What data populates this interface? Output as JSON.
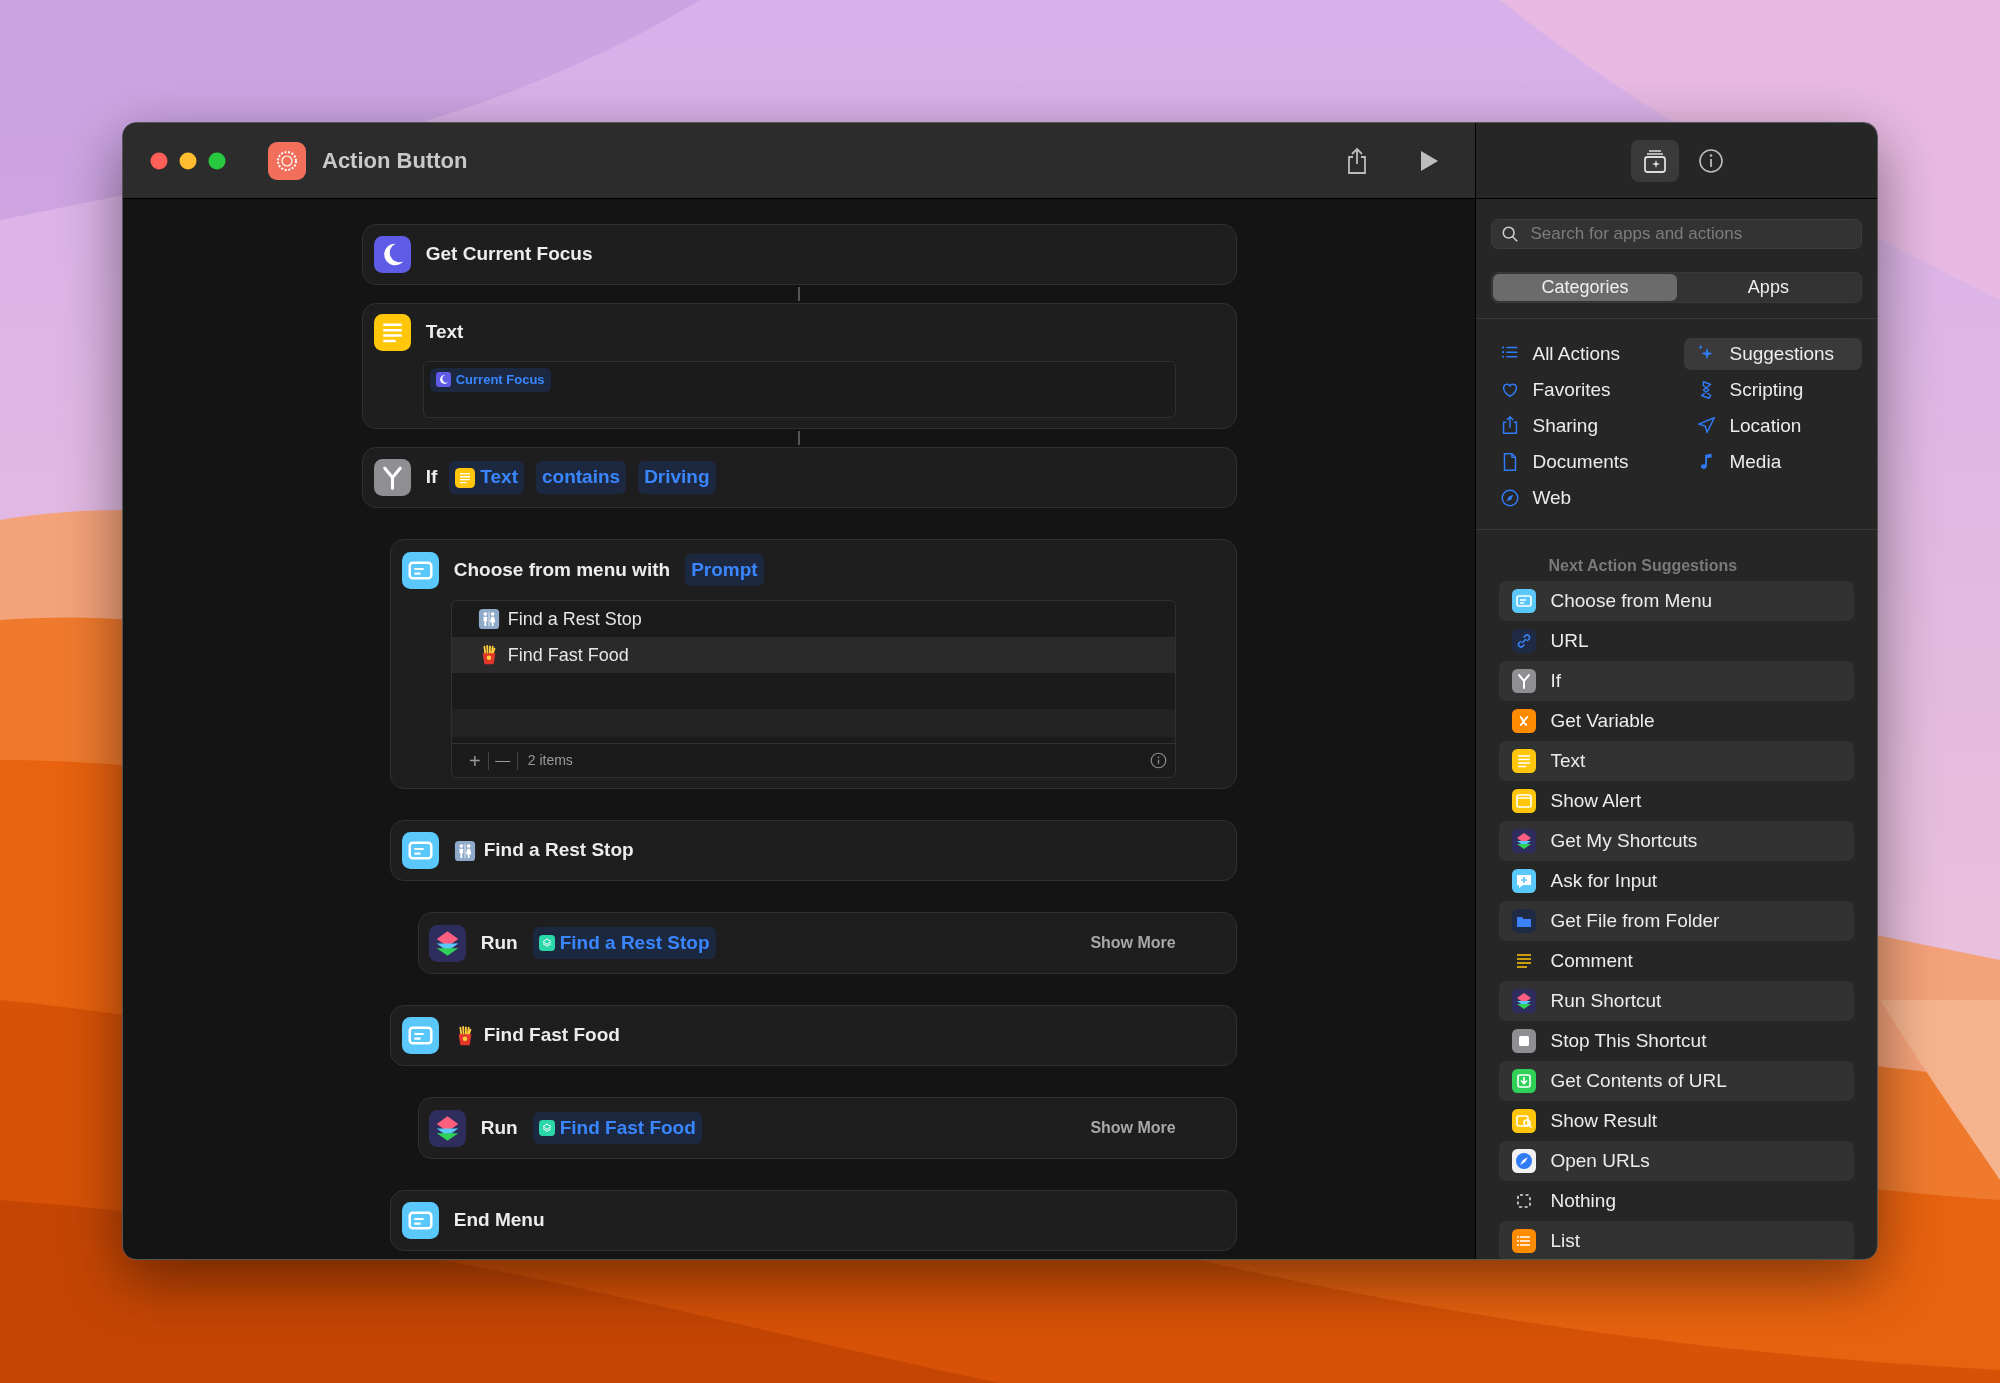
{
  "window": {
    "title": "Action Button"
  },
  "panel_tabs": [
    {
      "selected": true
    },
    {
      "selected": false
    }
  ],
  "actions": [
    {
      "kind": "focus",
      "title": "Get Current Focus"
    },
    {
      "kind": "text",
      "title": "Text",
      "field_token": "Current Focus"
    },
    {
      "kind": "if",
      "title": "If",
      "tokens": [
        {
          "kind": "text",
          "label": "Text"
        },
        {
          "kind": "plain",
          "label": "contains"
        },
        {
          "kind": "plain",
          "label": "Driving"
        }
      ],
      "children": [
        {
          "kind": "menu",
          "title": "Choose from menu with",
          "token": "Prompt",
          "items": [
            "Find a Rest Stop",
            "Find Fast Food"
          ],
          "add": "+",
          "remove": "—",
          "count": "2 items"
        },
        {
          "kind": "case",
          "title": "Find a Rest Stop",
          "children": [
            {
              "kind": "run",
              "title": "Run",
              "token": "Find a Rest Stop",
              "more": "Show More"
            }
          ]
        },
        {
          "kind": "case",
          "title": "Find Fast Food",
          "children": [
            {
              "kind": "run",
              "title": "Run",
              "token": "Find Fast Food",
              "more": "Show More"
            }
          ]
        },
        {
          "kind": "end",
          "title": "End Menu"
        }
      ]
    }
  ],
  "sidebar": {
    "search": {
      "placeholder": "Search for apps and actions"
    },
    "segments": [
      {
        "label": "Categories",
        "selected": true
      },
      {
        "label": "Apps",
        "selected": false
      }
    ],
    "categories": [
      {
        "label": "All Actions",
        "selected": false
      },
      {
        "label": "Suggestions",
        "selected": true
      },
      {
        "label": "Favorites",
        "selected": false
      },
      {
        "label": "Scripting",
        "selected": false
      },
      {
        "label": "Sharing",
        "selected": false
      },
      {
        "label": "Location",
        "selected": false
      },
      {
        "label": "Documents",
        "selected": false
      },
      {
        "label": "Media",
        "selected": false
      },
      {
        "label": "Web",
        "selected": false
      }
    ],
    "suggestions_title": "Next Action Suggestions",
    "suggestions": [
      "Choose from Menu",
      "URL",
      "If",
      "Get Variable",
      "Text",
      "Show Alert",
      "Get My Shortcuts",
      "Ask for Input",
      "Get File from Folder",
      "Comment",
      "Run Shortcut",
      "Stop This Shortcut",
      "Get Contents of URL",
      "Show Result",
      "Open URLs",
      "Nothing",
      "List"
    ]
  }
}
